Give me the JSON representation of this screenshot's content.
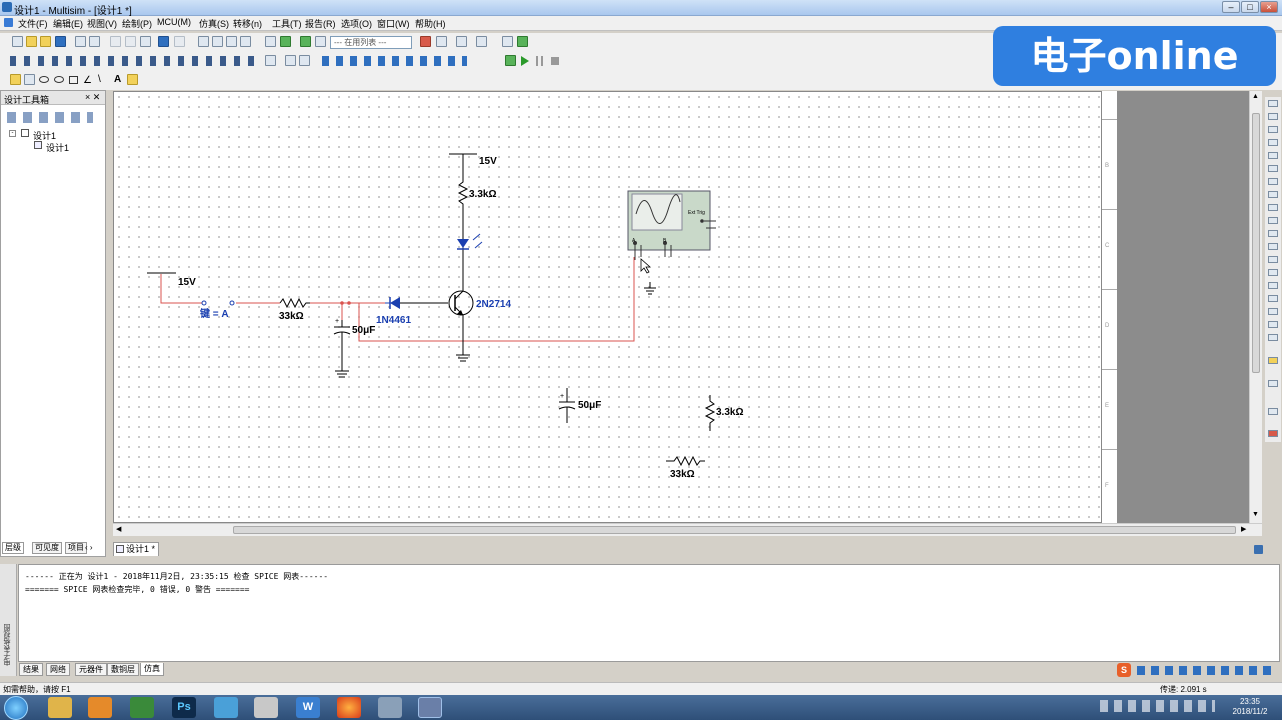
{
  "window": {
    "title": "设计1 - Multisim - [设计1 *]"
  },
  "menu": [
    "文件(F)",
    "编辑(E)",
    "视图(V)",
    "绘制(P)",
    "MCU(M)",
    "仿真(S)",
    "转移(n)",
    "工具(T)",
    "报告(R)",
    "选项(O)",
    "窗口(W)",
    "帮助(H)"
  ],
  "toolbar": {
    "in_use_list": "--- 在用列表 ---"
  },
  "watermark": "电子online",
  "design_toolbox": {
    "title": "设计工具箱",
    "tree_root": "设计1",
    "tree_child": "设计1",
    "tabs": [
      "层级",
      "可见度",
      "项目"
    ]
  },
  "schematic": {
    "tab_label": "设计1 *",
    "labels": {
      "vcc_top": "15V",
      "r_top": "3.3kΩ",
      "vcc_left": "15V",
      "key": "键 = A",
      "r_left": "33kΩ",
      "diode": "1N4461",
      "transistor": "2N2714",
      "cap_main": "50μF",
      "cap_loose": "50μF",
      "r_loose_v": "3.3kΩ",
      "r_loose_h": "33kΩ",
      "scope_ext": "Ext Trig",
      "scope_a": "A",
      "scope_b": "B"
    },
    "border_letters": [
      "B",
      "C",
      "D",
      "E",
      "F"
    ]
  },
  "output": {
    "lines": [
      "------ 正在为 设计1 - 2018年11月2日, 23:35:15 检查 SPICE 网表------",
      "======= SPICE 网表检查完毕, 0 错误, 0 警告 ======="
    ],
    "side_label": "电子表格视图",
    "tabs": [
      "结果",
      "网络",
      "元器件",
      "敷铜层",
      "仿真"
    ]
  },
  "status": {
    "help": "如需帮助，请按 F1",
    "sim_time": "传递: 2.091 s"
  },
  "taskbar": {
    "time": "23:35",
    "date": "2018/11/2"
  },
  "colors": {
    "wire": "#d9534f",
    "component_blue": "#1a3fb0",
    "watermark_bg": "#2f7fe0",
    "scope_body": "#c9d9c9"
  }
}
